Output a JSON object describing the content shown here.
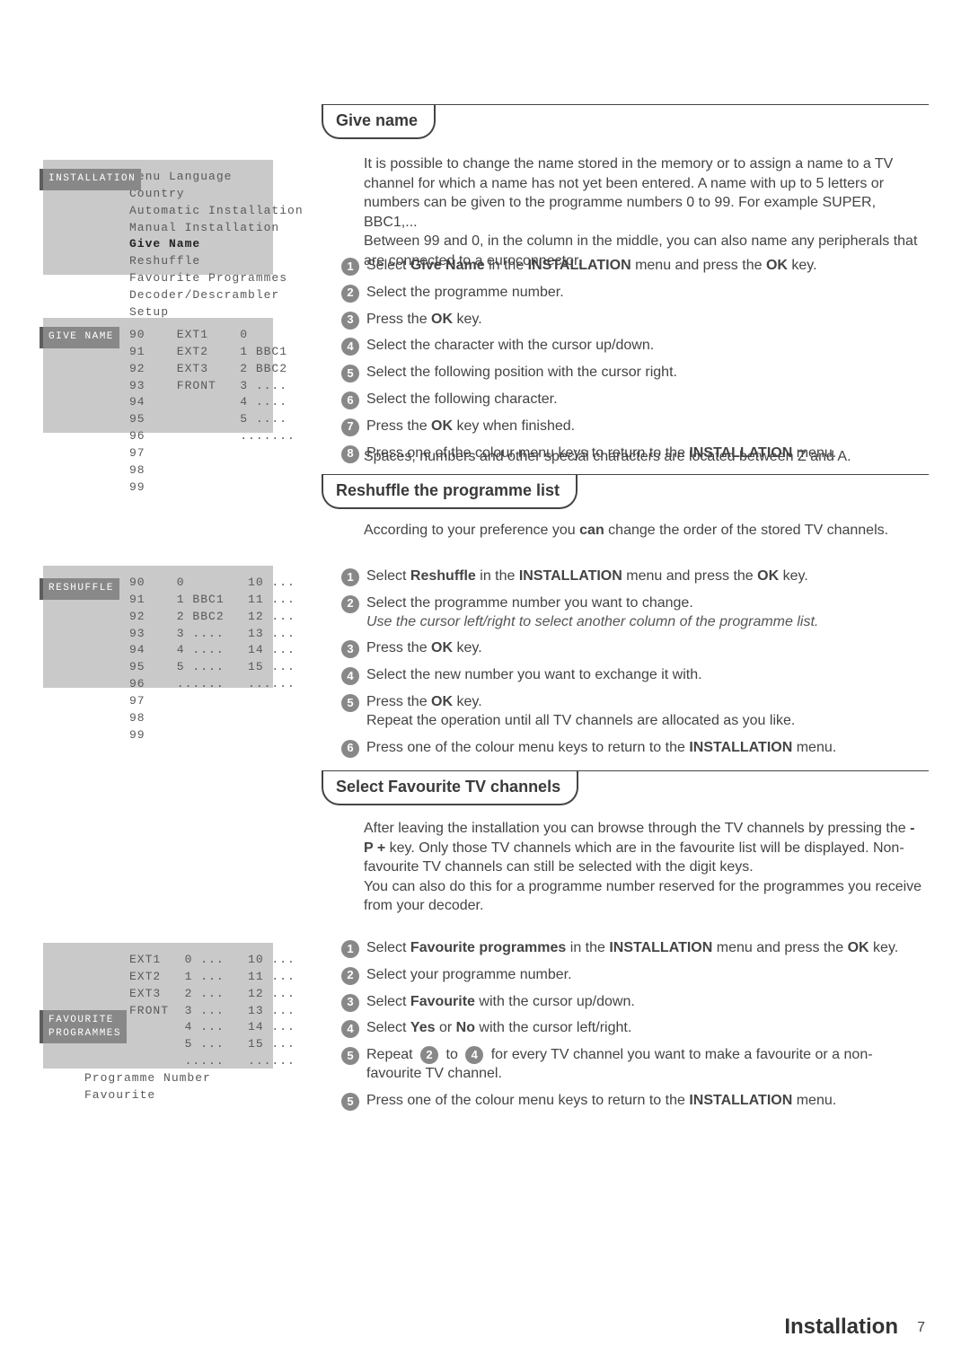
{
  "page": {
    "section": "Installation",
    "number": "7"
  },
  "s1": {
    "heading": "Give name",
    "intro": "It is possible to change the name stored in the memory or to assign a name to a TV channel for which a name has not yet been entered. A name with up to 5 letters or numbers can be given to the programme numbers 0 to 99. For example SUPER, BBC1,...\nBetween 99 and 0, in the column in the middle, you can also name any peripherals that are connected to a euroconnector.",
    "steps": [
      {
        "pre": "Select ",
        "b1": "Give Name",
        "mid": " in the ",
        "b2": "INSTALLATION",
        "post": " menu and press the ",
        "b3": "OK",
        "tail": " key."
      },
      {
        "text": "Select the programme number."
      },
      {
        "pre": "Press the ",
        "b1": "OK",
        "post": " key."
      },
      {
        "text": "Select the character with the cursor up/down."
      },
      {
        "text": "Select the following position with the cursor right."
      },
      {
        "text": "Select the following character."
      },
      {
        "pre": "Press the ",
        "b1": "OK",
        "post": " key when finished."
      },
      {
        "pre": "Press one of the colour menu keys to return to the ",
        "b1": "INSTALLATION",
        "post": " menu."
      }
    ],
    "note": "Spaces, numbers and other special characters are located between Z and A."
  },
  "s2": {
    "heading": "Reshuffle the programme list",
    "intro_pre": "According to your preference you ",
    "intro_b": "can",
    "intro_post": " change the order of the stored TV channels.",
    "steps": [
      {
        "pre": "Select ",
        "b1": "Reshuffle",
        "mid": " in the ",
        "b2": "INSTALLATION",
        "post": " menu and press the ",
        "b3": "OK",
        "tail": " key."
      },
      {
        "text": "Select the programme number you want to change.",
        "hint": "Use the cursor left/right to select another column of the programme list."
      },
      {
        "pre": "Press the ",
        "b1": "OK",
        "post": " key."
      },
      {
        "text": "Select the new number you want to exchange it with."
      },
      {
        "pre": "Press the ",
        "b1": "OK",
        "post": " key.",
        "extra": "Repeat the operation until all TV channels are allocated as you like."
      },
      {
        "pre": "Press one of the colour menu keys to return to the ",
        "b1": "INSTALLATION",
        "post": " menu."
      }
    ]
  },
  "s3": {
    "heading": "Select Favourite TV channels",
    "intro_a": "After leaving the installation you can browse through the TV channels by pressing the ",
    "intro_b1": "- P +",
    "intro_c": " key. Only those TV channels which are in the favourite list will be displayed. Non-favourite TV channels can still be selected with the digit keys.",
    "intro_d": "You can also do this for a programme number reserved for the programmes you receive from your decoder.",
    "steps": [
      {
        "pre": "Select ",
        "b1": "Favourite programmes",
        "mid": " in the ",
        "b2": "INSTALLATION",
        "post": " menu and press the ",
        "b3": "OK",
        "tail": " key."
      },
      {
        "text": "Select your programme number."
      },
      {
        "pre": "Select ",
        "b1": "Favourite",
        "post": " with the cursor up/down."
      },
      {
        "pre": "Select ",
        "b1": "Yes",
        "mid": " or ",
        "b2": "No",
        "post": " with the cursor left/right."
      },
      {
        "pre": "Repeat ",
        "chip1": "2",
        "mid2": " to ",
        "chip2": "4",
        "post": " for every TV channel you want to make a favourite or a non-favourite TV channel."
      },
      {
        "pre": "Press one of the colour menu keys to return to the ",
        "b1": "INSTALLATION",
        "post": " menu."
      }
    ]
  },
  "osd": {
    "install": {
      "tab": "INSTALLATION",
      "l1": "Menu Language",
      "l2": "Country",
      "l3": "Automatic Installation",
      "l4": "Manual Installation",
      "l5": "Give Name",
      "l6": "Reshuffle",
      "l7": "Favourite Programmes",
      "l8": "Decoder/Descrambler",
      "l9": "Setup"
    },
    "givename": {
      "tab": "GIVE NAME",
      "r1": "90    EXT1    0",
      "r2": "91    EXT2    1 BBC1",
      "r3": "92    EXT3    2 BBC2",
      "r4": "93    FRONT   3 ....",
      "r5": "94            4 ....",
      "r6": "95            5 ....",
      "r7": "96            .......",
      "r8": "97",
      "r9": "98",
      "r10": "99"
    },
    "reshuffle": {
      "tab": "RESHUFFLE",
      "r1": "90    0        10 ...",
      "r2": "91    1 BBC1   11 ...",
      "r3": "92    2 BBC2   12 ...",
      "r4": "93    3 ....   13 ...",
      "r5": "94    4 ....   14 ...",
      "r6": "95    5 ....   15 ...",
      "r7": "96    ......   ......",
      "r8": "97",
      "r9": "98",
      "r10": "99"
    },
    "fav": {
      "tab": "FAVOURITE\nPROGRAMMES",
      "r1": "EXT1   0 ...   10 ...",
      "r2": "EXT2   1 ...   11 ...",
      "r3": "EXT3   2 ...   12 ...",
      "r4": "FRONT  3 ...   13 ...",
      "r5": "       4 ...   14 ...",
      "r6": "       5 ...   15 ...",
      "r7": "       .....   ......",
      "f1": "Programme Number",
      "f2": "Favourite"
    }
  }
}
